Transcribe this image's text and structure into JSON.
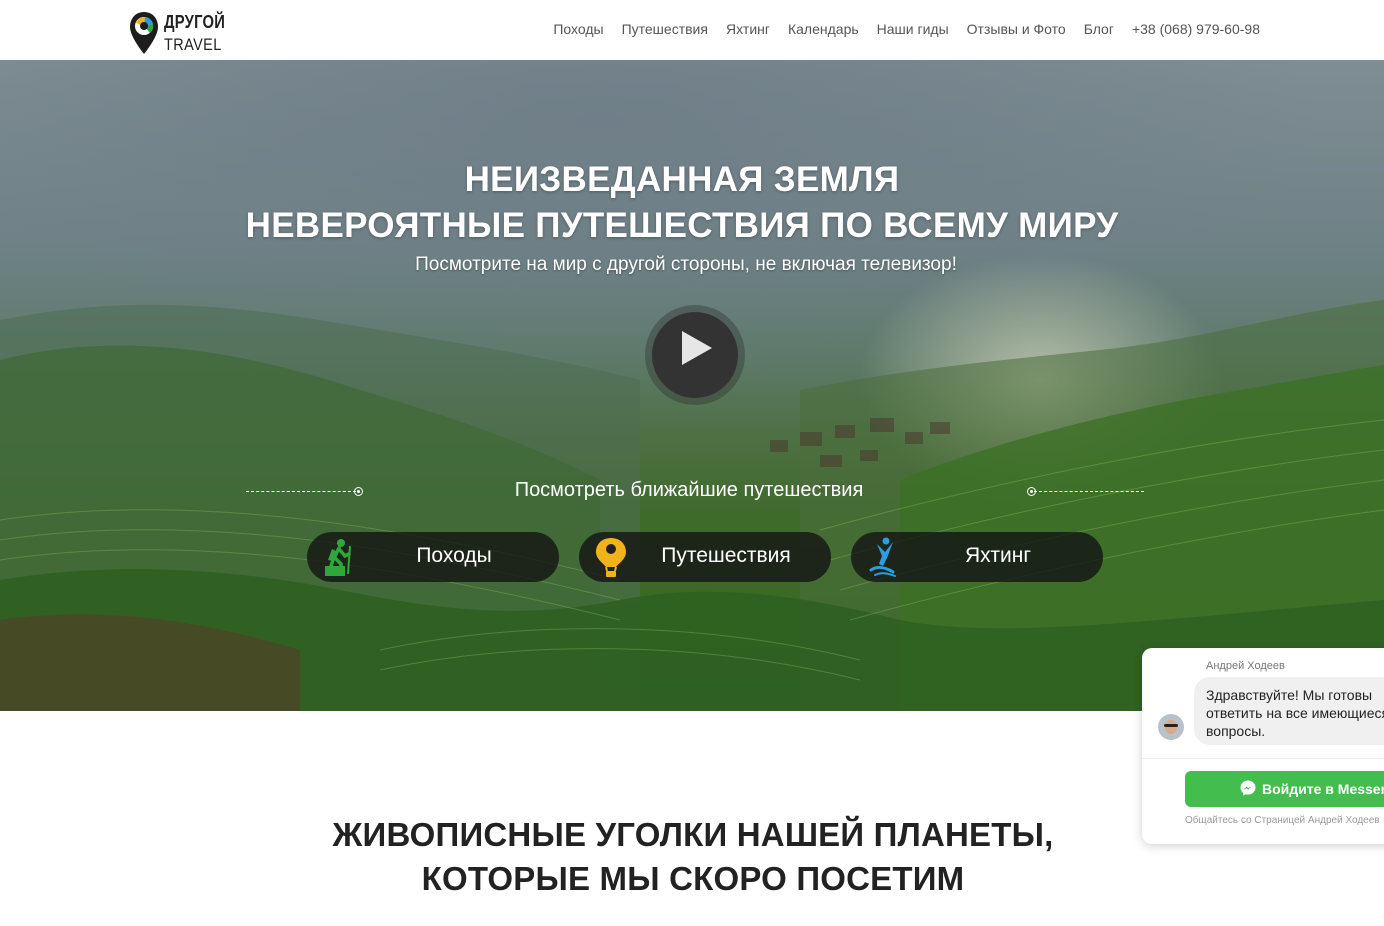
{
  "header": {
    "logo": {
      "top": "ДРУГОЙ",
      "bottom": "TRAVEL"
    },
    "nav": [
      {
        "label": "Походы"
      },
      {
        "label": "Путешествия"
      },
      {
        "label": "Яхтинг"
      },
      {
        "label": "Календарь"
      },
      {
        "label": "Наши гиды"
      },
      {
        "label": "Отзывы и Фото"
      },
      {
        "label": "Блог"
      },
      {
        "label": "+38 (068) 979-60-98"
      }
    ]
  },
  "hero": {
    "title_line1": "НЕИЗВЕДАННАЯ ЗЕМЛЯ",
    "title_line2": "НЕВЕРОЯТНЫЕ ПУТЕШЕСТВИЯ ПО ВСЕМУ МИРУ",
    "subtitle": "Посмотрите на мир с другой стороны, не включая телевизор!",
    "nearest_label": "Посмотреть ближайшие путешествия",
    "categories": [
      {
        "label": "Походы",
        "icon": "hiker-icon",
        "color": "#2ea83a"
      },
      {
        "label": "Путешествия",
        "icon": "hot-air-balloon-icon",
        "color": "#f2b21c"
      },
      {
        "label": "Яхтинг",
        "icon": "yachting-icon",
        "color": "#2a9fe0"
      }
    ]
  },
  "section": {
    "title_line1": "ЖИВОПИСНЫЕ УГОЛКИ НАШЕЙ ПЛАНЕТЫ,",
    "title_line2": "КОТОРЫЕ МЫ СКОРО ПОСЕТИМ"
  },
  "chat": {
    "agent_name": "Андрей Ходеев",
    "message": "Здравствуйте! Мы готовы ответить на все имеющиеся вопросы.",
    "button_label": "Войдите в Messenger",
    "footer": "Общайтесь со Страницей Андрей Ходеев",
    "button_color": "#44bd4f"
  }
}
